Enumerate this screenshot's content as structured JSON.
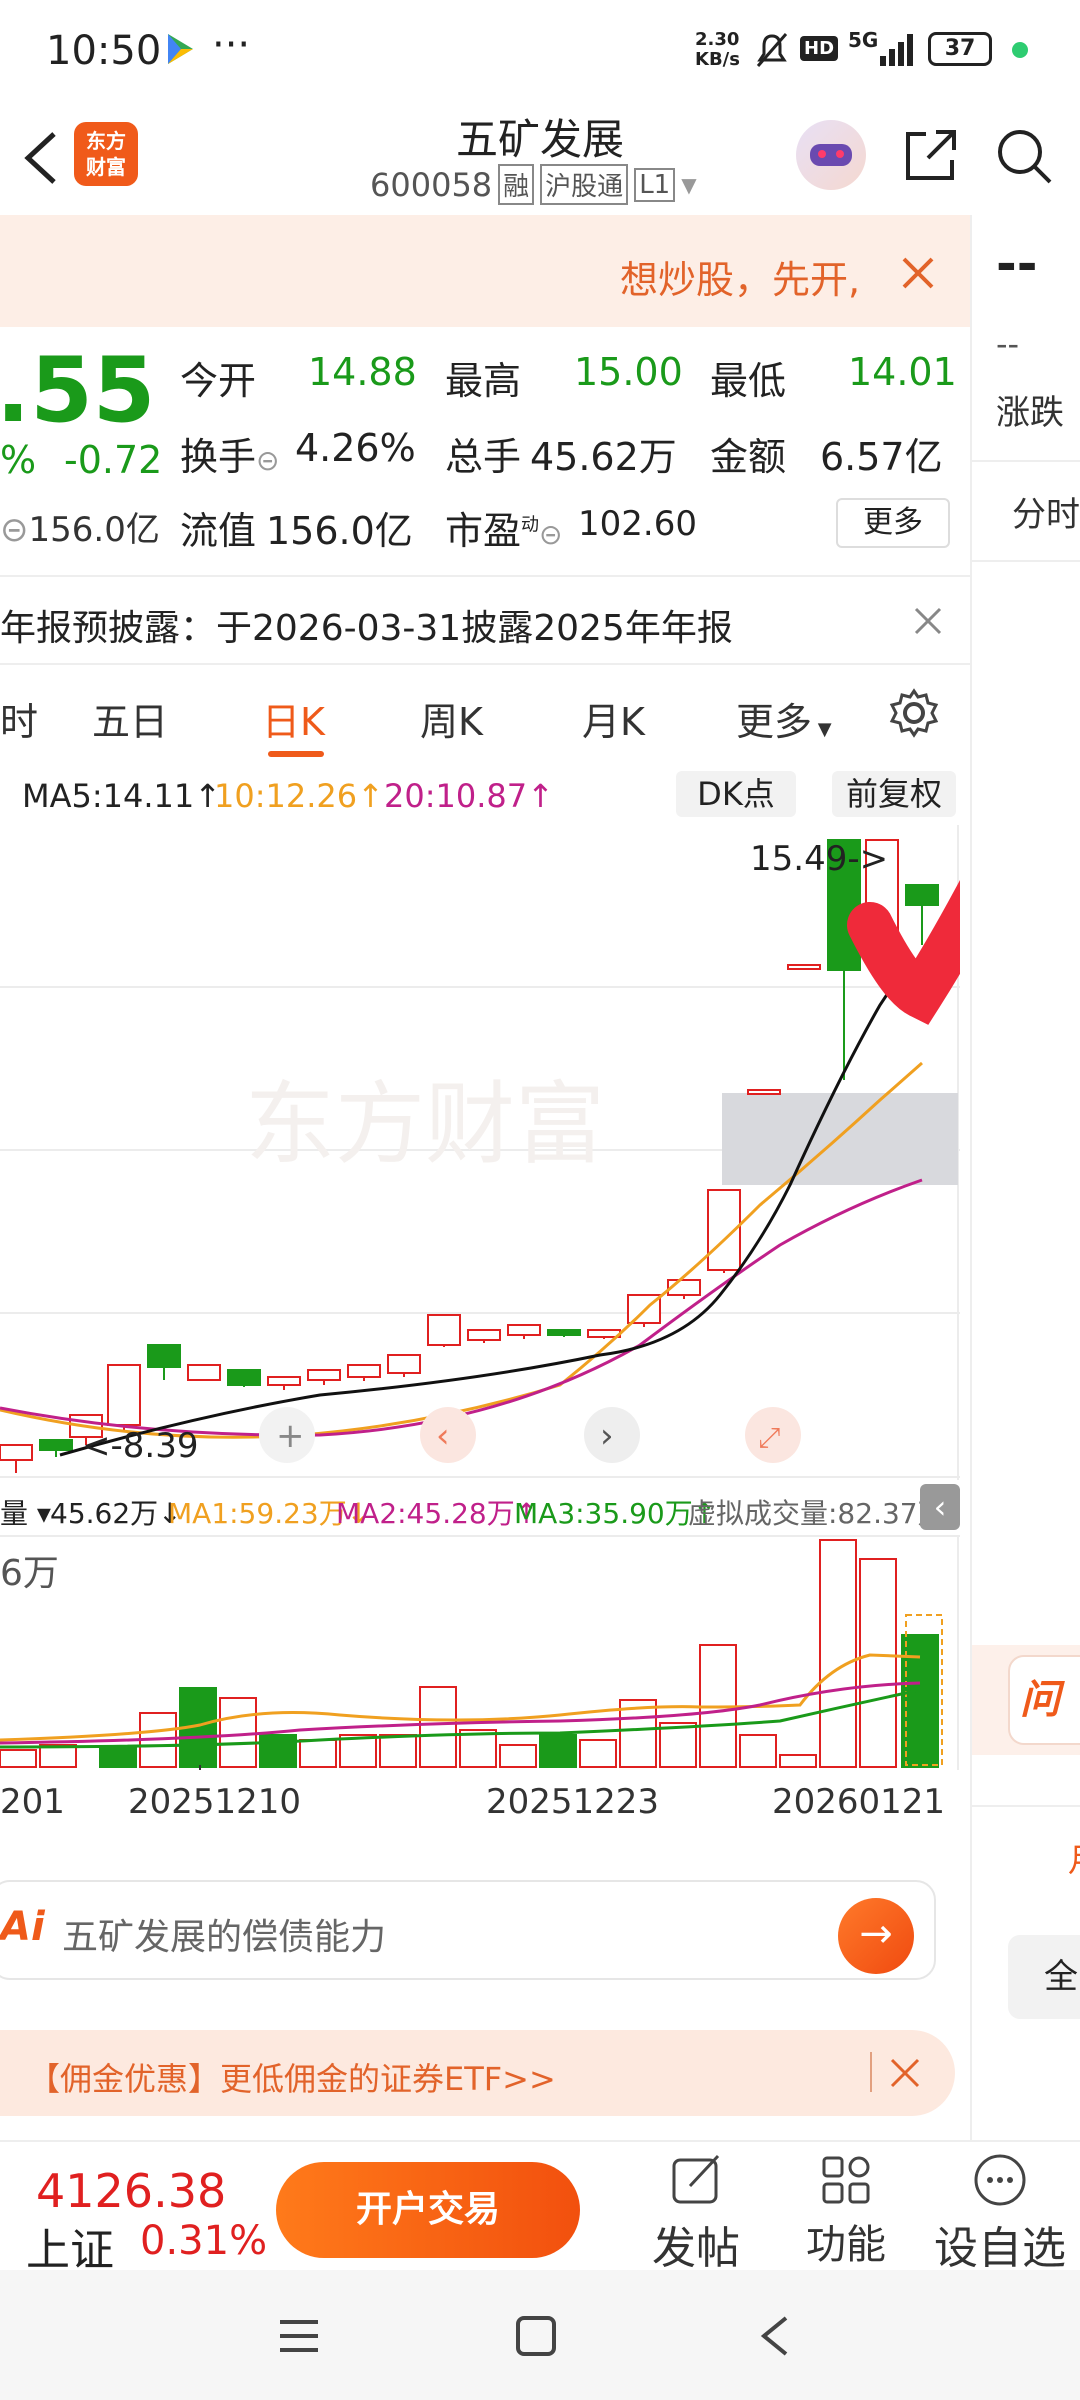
{
  "status": {
    "time": "10:50",
    "dots": "···",
    "net_speed_top": "2.30",
    "net_speed_bottom": "KB/s",
    "hd": "HD",
    "signal": "5G",
    "battery": "37"
  },
  "header": {
    "title": "五矿发展",
    "code": "600058",
    "badge_rong": "融",
    "badge_hgt": "沪股通",
    "badge_level": "L1",
    "logo_line1": "东方",
    "logo_line2": "财富"
  },
  "promo": {
    "text": "想炒股，先开,"
  },
  "quote": {
    "price": ".55",
    "pct": "%",
    "change": "-0.72",
    "mcap_partial": "156.0亿",
    "open_label": "今开",
    "open": "14.88",
    "high_label": "最高",
    "high": "15.00",
    "low_label": "最低",
    "low": "14.01",
    "turnover_label": "换手",
    "turnover": "4.26%",
    "volume_label": "总手",
    "volume": "45.62万",
    "amount_label": "金额",
    "amount": "6.57亿",
    "float_label": "流值",
    "float_cap": "156.0亿",
    "pe_label": "市盈",
    "pe_sup": "动",
    "pe": "102.60",
    "more": "更多"
  },
  "notice": {
    "text": "年报预披露：于2026-03-31披露2025年年报"
  },
  "tabs": {
    "t0": "时",
    "t1": "五日",
    "t2": "日K",
    "t3": "周K",
    "t4": "月K",
    "t5": "更多"
  },
  "ma": {
    "ma5": "MA5:14.11↑",
    "ma10": "10:12.26↑",
    "ma20": "20:10.87↑",
    "dk": "DK点",
    "fq": "前复权"
  },
  "chart": {
    "watermark": "东方财富",
    "max_label": "15.49->",
    "min_label": "<-8.39",
    "colors": {
      "up": "#e02020",
      "down": "#1a9a1a",
      "ma5": "#111111",
      "ma10": "#f0a020",
      "ma20": "#c0208a"
    }
  },
  "vol": {
    "label": "量",
    "value": "45.62万↓",
    "ma1": "MA1:59.23万↓",
    "ma2": "MA2:45.28万↑",
    "ma3": "MA3:35.90万↑",
    "virtual": "虚拟成交量:82.37万",
    "axis": "6万"
  },
  "dates": {
    "d0": "201",
    "d1": "20251210",
    "d2": "20251223",
    "d3": "20260121"
  },
  "ai": {
    "label": "Ai",
    "text": "五矿发展的偿债能力"
  },
  "ad": {
    "text": "【佣金优惠】更低佣金的证券ETF>>"
  },
  "bottom": {
    "index_value": "4126.38",
    "index_name": "上证",
    "index_pct": "0.31%",
    "trade_button": "开户交易",
    "post": "发帖",
    "func": "功能",
    "watch": "设自选"
  },
  "right": {
    "dash": "--",
    "dash2": "--",
    "label1": "涨跌",
    "tab": "分时",
    "label2": "问",
    "label3": "月",
    "label4": "全"
  }
}
